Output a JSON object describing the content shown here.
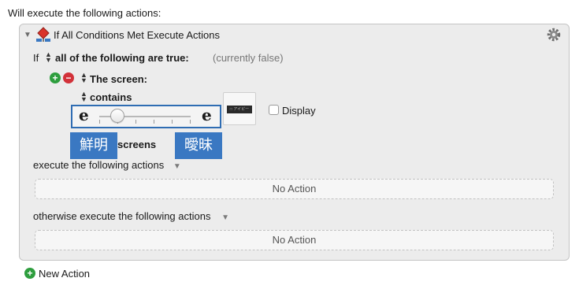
{
  "header": {
    "title": "Will execute the following actions:"
  },
  "action": {
    "title": "If All Conditions Met Execute Actions",
    "icon": "if-then-icon",
    "settings_icon": "gear-icon"
  },
  "condition": {
    "if_label": "If",
    "mode": "all of the following are true:",
    "status": "(currently false)",
    "screen_label": "The screen:",
    "operator": "contains",
    "slider": {
      "left_glyph": "e",
      "right_glyph": "e",
      "value_fraction": 0.2
    },
    "thumbnail_text": "□ アイピー",
    "display_label": "Display",
    "display_checked": false,
    "screens_label": "screens"
  },
  "callouts": {
    "left": "鮮明",
    "right": "曖昧"
  },
  "then_section": {
    "label": "execute the following actions",
    "slot": "No Action"
  },
  "else_section": {
    "label": "otherwise execute the following actions",
    "slot": "No Action"
  },
  "footer": {
    "new_action": "New Action"
  },
  "colors": {
    "accent": "#3a78c2",
    "add": "#2e9e3e",
    "remove": "#d2323a"
  }
}
